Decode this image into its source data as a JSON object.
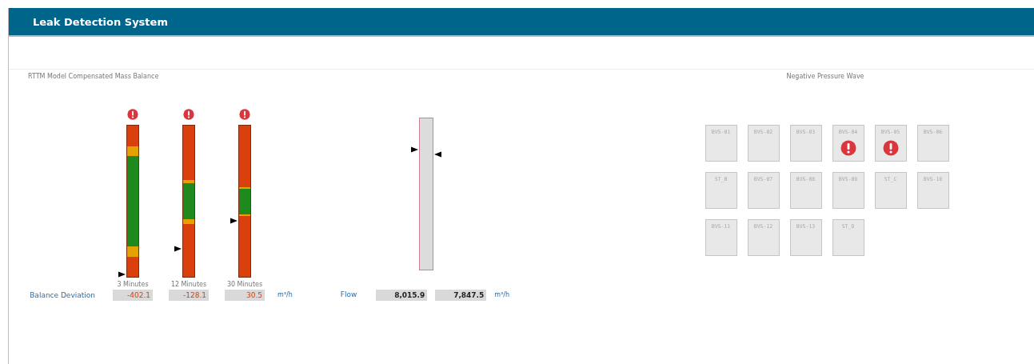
{
  "window": {
    "title": "Leak Detection System"
  },
  "mass_balance": {
    "title": "RTTM Model Compensated Mass Balance",
    "row_label": "Balance Deviation",
    "unit": "m³/h",
    "gauges": [
      {
        "label": "3 Minutes",
        "value": "-402.1",
        "alarm": true
      },
      {
        "label": "12 Minutes",
        "value": "-128.1",
        "alarm": true
      },
      {
        "label": "30 Minutes",
        "value": "30.5",
        "alarm": true
      }
    ]
  },
  "flow": {
    "label": "Flow",
    "unit": "m³/h",
    "inlet": {
      "value": "8,015.9"
    },
    "outlet": {
      "value": "7,847.5"
    }
  },
  "pressure_wave": {
    "title": "Negative Pressure Wave",
    "stations": [
      {
        "label": "BVS-01",
        "alarm": false
      },
      {
        "label": "BVS-02",
        "alarm": false
      },
      {
        "label": "BVS-03",
        "alarm": false
      },
      {
        "label": "BVS-04",
        "alarm": true
      },
      {
        "label": "BVS-05",
        "alarm": true
      },
      {
        "label": "BVS-06",
        "alarm": false
      },
      {
        "label": "ST_B",
        "alarm": false
      },
      {
        "label": "BVS-07",
        "alarm": false
      },
      {
        "label": "BVS-08",
        "alarm": false
      },
      {
        "label": "BVS-09",
        "alarm": false
      },
      {
        "label": "ST_C",
        "alarm": false
      },
      {
        "label": "BVS-10",
        "alarm": false
      },
      {
        "label": "BVS-11",
        "alarm": false
      },
      {
        "label": "BVS-12",
        "alarm": false
      },
      {
        "label": "BVS-13",
        "alarm": false
      },
      {
        "label": "ST_D",
        "alarm": false
      }
    ]
  }
}
